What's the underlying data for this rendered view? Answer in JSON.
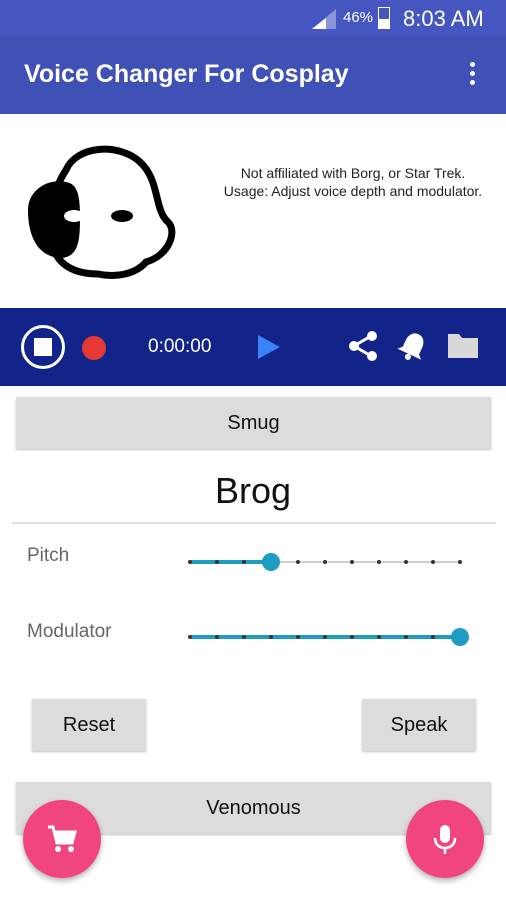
{
  "status_bar": {
    "battery_percent": "46%",
    "time": "8:03 AM",
    "battery_level": 0.46,
    "icons": [
      "signal-icon",
      "battery-icon"
    ]
  },
  "app_bar": {
    "title": "Voice Changer For Cosplay",
    "menu_icon": "overflow-menu-icon"
  },
  "header": {
    "logo_icon": "borg-head-logo",
    "disclaimer": "Not affiliated with Borg, or Star Trek.  Usage: Adjust voice depth and modulator."
  },
  "player": {
    "time": "0:00:00",
    "icons": [
      "stop-icon",
      "record-icon",
      "play-icon",
      "share-icon",
      "bell-icon",
      "folder-icon"
    ],
    "record_color": "#e53935",
    "play_color": "#3b82f6",
    "bar_color": "#12248a"
  },
  "voices": {
    "previous": "Smug",
    "current": "Brog",
    "next": "Venomous"
  },
  "sliders": {
    "pitch": {
      "label": "Pitch",
      "steps": 11,
      "value_index": 3
    },
    "modulator": {
      "label": "Modulator",
      "steps": 11,
      "value_index": 10
    }
  },
  "actions": {
    "reset_label": "Reset",
    "speak_label": "Speak"
  },
  "fabs": {
    "left_icon": "cart-icon",
    "right_icon": "microphone-icon",
    "color": "#f0457f"
  }
}
